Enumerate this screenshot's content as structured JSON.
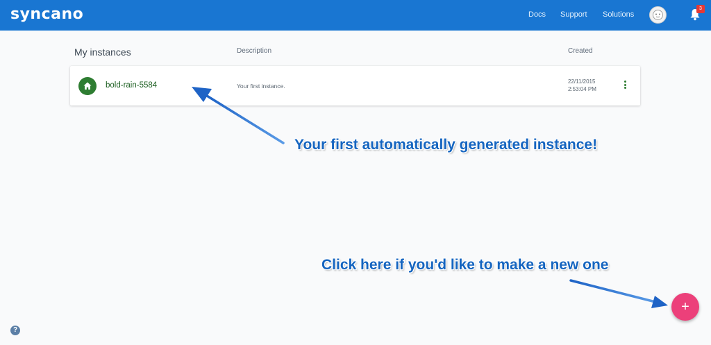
{
  "header": {
    "logo": "syncano",
    "nav": [
      "Docs",
      "Support",
      "Solutions"
    ],
    "notification_count": "3"
  },
  "list": {
    "title": "My instances",
    "col_description": "Description",
    "col_created": "Created"
  },
  "instances": [
    {
      "name": "bold-rain-5584",
      "description": "Your first instance.",
      "created_date": "22/11/2015",
      "created_time": "2:53:04 PM",
      "icon": "home-icon"
    }
  ],
  "annotations": {
    "first_instance": "Your first automatically generated instance!",
    "make_new": "Click here if you'd like to make a new one"
  },
  "fab": {
    "label": "+"
  },
  "help": {
    "label": "?"
  },
  "colors": {
    "topbar": "#1976d2",
    "instance_icon": "#2e7d32",
    "fab": "#ec407a",
    "annotation": "#1565c0"
  }
}
